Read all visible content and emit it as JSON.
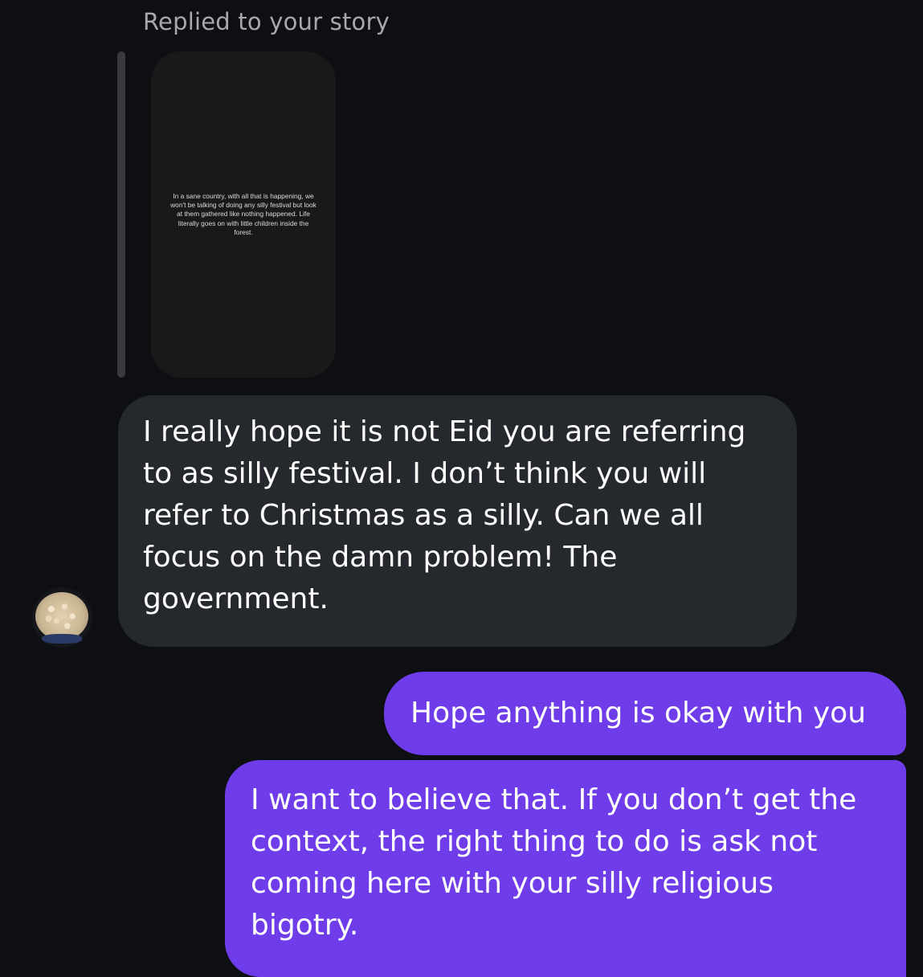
{
  "chat": {
    "reply_header": "Replied to your story",
    "story": {
      "text": "In a sane country, with all that is happening, we won't be talking of doing any silly festival but look at them gathered like nothing happened. Life literally goes on with little children inside the forest."
    },
    "messages": [
      {
        "sender": "them",
        "text": "I really hope it is not Eid you are referring to as silly festival. I don’t think you will refer to Christmas as a silly. Can we all focus on the damn problem! The government."
      },
      {
        "sender": "me",
        "text": "Hope anything is okay with you"
      },
      {
        "sender": "me",
        "text": "I want to believe that. If you don’t get the context, the right thing to do is ask not coming here with your silly religious bigotry."
      }
    ],
    "colors": {
      "background": "#0d0f12",
      "incoming_bubble": "#25282d",
      "outgoing_bubble": "#6f3cea",
      "header_text": "#a8a8ad"
    }
  }
}
